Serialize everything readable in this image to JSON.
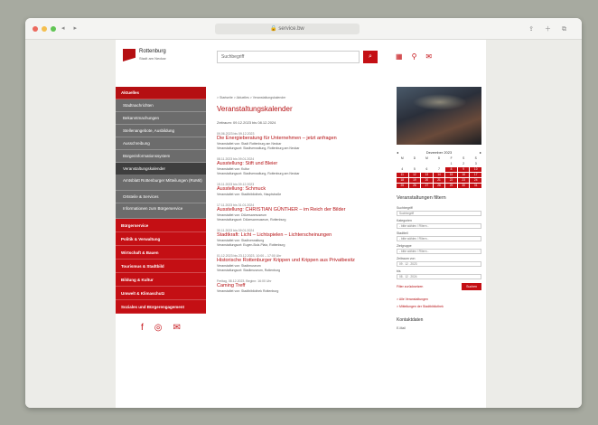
{
  "browser": {
    "url": "service.bw",
    "light_colors": [
      "#ec6a5e",
      "#f4bf4f",
      "#61c554"
    ]
  },
  "header": {
    "logo_title": "Rottenburg",
    "logo_subtitle": "Stadt am Neckar",
    "search_placeholder": "Suchbegriff",
    "search_button_icon": "search-icon"
  },
  "sidebar": {
    "items": [
      {
        "label": "Aktuelles",
        "kind": "head"
      },
      {
        "label": "Stadtnachrichten",
        "kind": "sub"
      },
      {
        "label": "Bekanntmachungen",
        "kind": "sub"
      },
      {
        "label": "Stellenangebote, Ausbildung",
        "kind": "sub"
      },
      {
        "label": "Ausschreibung",
        "kind": "sub"
      },
      {
        "label": "Bürgerinformationssystem",
        "kind": "sub"
      },
      {
        "label": "Veranstaltungskalender",
        "kind": "sub-active"
      },
      {
        "label": "Amtsblatt Rottenburger Mitteilungen (RoMit)",
        "kind": "sub-tall"
      },
      {
        "label": "Ortsteile & Services",
        "kind": "sub"
      },
      {
        "label": "Informationen zum Bürgerservice",
        "kind": "sub-tall"
      },
      {
        "label": "Bürgerservice",
        "kind": "main"
      },
      {
        "label": "Politik & Verwaltung",
        "kind": "main"
      },
      {
        "label": "Wirtschaft & Bauen",
        "kind": "main"
      },
      {
        "label": "Tourismus & Stadtbild",
        "kind": "main"
      },
      {
        "label": "Bildung & Kultur",
        "kind": "main"
      },
      {
        "label": "Umwelt & Klimaschutz",
        "kind": "main"
      },
      {
        "label": "Soziales und Bürgerengagement",
        "kind": "main"
      }
    ]
  },
  "main": {
    "breadcrumb": "> Startseite > Aktuelles > Veranstaltungskalender",
    "title": "Veranstaltungskalender",
    "period": "Zeitraum: 09.12.2023 bis 08.12.2024",
    "events": [
      {
        "date": "09.06.2023 bis 09.12.2023",
        "title": "Die Energieberatung für Unternehmen – jetzt anfragen",
        "meta1": "Veranstaltet von: Stadt Rottenburg am Neckar",
        "meta2": "Veranstaltungsort: Stadtverwaltung, Rottenburg am Neckar"
      },
      {
        "date": "08.11.2023 bis 09.01.2024",
        "title": "Ausstellung: Stift und Bleier",
        "meta1": "Veranstaltet von: Kultur",
        "meta2": "Veranstaltungsort: Stadtverwaltung, Rottenburg am Neckar"
      },
      {
        "date": "15.11.2023 bis 09.12.2023",
        "title": "Ausstellung: Schmuck",
        "meta1": "Veranstaltet von: Stadtbibliothek, Hauptstraße",
        "meta2": ""
      },
      {
        "date": "17.11.2023 bis 31.01.2024",
        "title": "Ausstellung: CHRISTIAN GÜNTHER – im Reich der Bilder",
        "meta1": "Veranstaltet von: Diözesanmuseum",
        "meta2": "Veranstaltungsort: Diözesanmuseum, Rottenburg"
      },
      {
        "date": "30.11.2023 bis 09.01.2024",
        "title": "Stadtkraft: Licht – Lichtspielen – Lichterscheinungen",
        "meta1": "Veranstaltet von: Stadtverwaltung",
        "meta2": "Veranstaltungsort: Eugen-Bolz-Platz, Rottenburg"
      },
      {
        "date": "01.12.2023 bis 23.12.2023, 10:00 – 17:00 Uhr",
        "title": "Historische Rottenburger Krippen und Krippen aus Privatbesitz",
        "meta1": "Veranstaltet von: Stadtmuseum",
        "meta2": "Veranstaltungsort: Stadtmuseum, Rottenburg"
      },
      {
        "date": "Freitag, 08.12.2023, Beginn: 16:00 Uhr",
        "title": "Caming Treff",
        "meta1": "Veranstaltet von: Stadtbibliothek Rottenburg",
        "meta2": ""
      }
    ]
  },
  "right": {
    "calendar": {
      "month": "Dezember 2023",
      "weekdays": [
        "M",
        "D",
        "M",
        "D",
        "F",
        "S",
        "S"
      ],
      "days": [
        "",
        "",
        "",
        "",
        "1",
        "2",
        "3",
        "4",
        "5",
        "6",
        "7",
        "8",
        "9",
        "10",
        "11",
        "12",
        "13",
        "14",
        "15",
        "16",
        "17",
        "18",
        "19",
        "20",
        "21",
        "22",
        "23",
        "24",
        "25",
        "26",
        "27",
        "28",
        "29",
        "30",
        "31"
      ],
      "highlight_from": 8
    },
    "filter_title": "Veranstaltungen filtern",
    "fields": [
      {
        "label": "Suchbegriff",
        "value": "Suchbegriff"
      },
      {
        "label": "Kategorien",
        "value": "- bitte wählen / Filtern -"
      },
      {
        "label": "Stadtteil",
        "value": "- bitte wählen / Filtern -"
      },
      {
        "label": "Zielgruppe",
        "value": "- bitte wählen / Filtern -"
      },
      {
        "label": "Zeitraum von",
        "value": "09 . 12 . 2023"
      },
      {
        "label": "bis",
        "value": "08 . 12 . 2024"
      }
    ],
    "reset_label": "Filter zurücksetzen",
    "apply_label": "Suchen",
    "links": [
      "> Alle Veranstaltungen",
      "> Mitteilungen der Stadtbibliothek"
    ],
    "export_title": "Kontaktdaten",
    "export_item": "E-Mail"
  }
}
